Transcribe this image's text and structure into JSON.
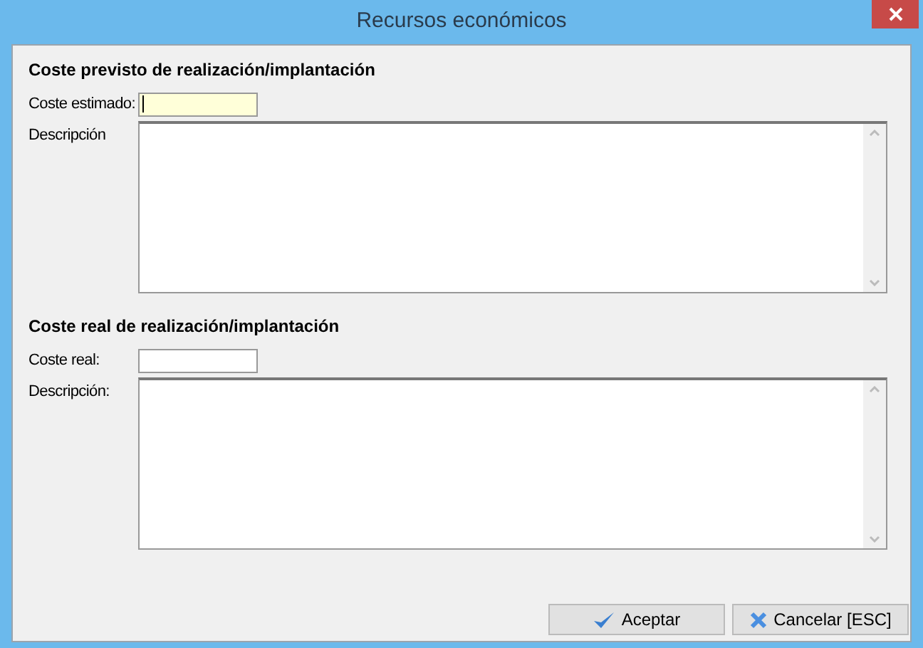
{
  "window": {
    "title": "Recursos económicos"
  },
  "sections": [
    {
      "heading": "Coste previsto de realización/implantación",
      "field": {
        "label": "Coste estimado:",
        "focused": true
      },
      "description": {
        "label": "Descripción"
      }
    },
    {
      "heading": "Coste real de realización/implantación",
      "field": {
        "label": "Coste real:",
        "focused": false
      },
      "description": {
        "label": "Descripción:"
      }
    }
  ],
  "buttons": [
    {
      "label": "Aceptar",
      "kind": "ok"
    },
    {
      "label": "Cancelar [ESC]",
      "kind": "cancel"
    }
  ]
}
